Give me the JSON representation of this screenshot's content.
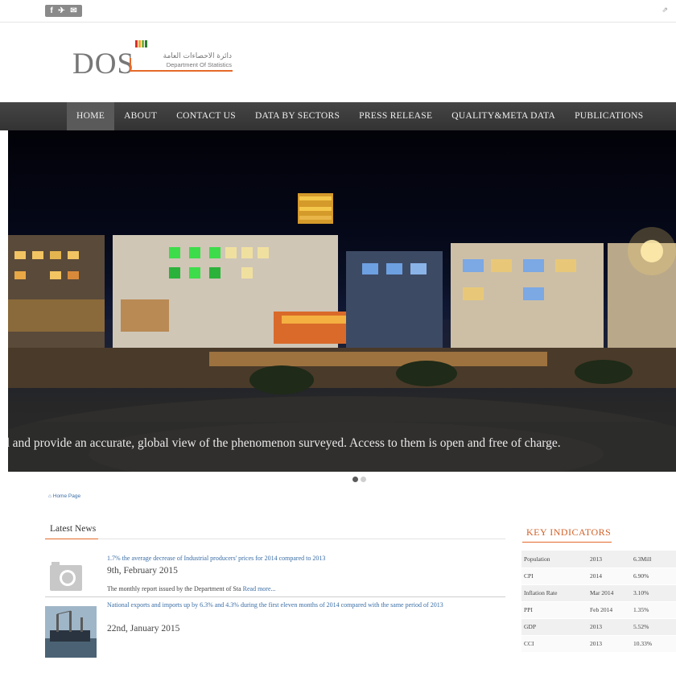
{
  "social": {
    "icons": [
      "f",
      "✈",
      "✉"
    ]
  },
  "logo": {
    "main": "DOS",
    "arabic": "دائرة الاحصاءات العامة",
    "english": "Department Of Statistics",
    "bar_colors": [
      "#d8322c",
      "#f0a830",
      "#7cb342",
      "#2e7d32"
    ],
    "accent": "#e56a2a"
  },
  "nav": {
    "items": [
      {
        "label": "HOME",
        "active": true
      },
      {
        "label": "ABOUT"
      },
      {
        "label": "CONTACT US"
      },
      {
        "label": "DATA BY SECTORS"
      },
      {
        "label": "PRESS RELEASE"
      },
      {
        "label": "QUALITY&META DATA"
      },
      {
        "label": "PUBLICATIONS"
      }
    ]
  },
  "hero": {
    "caption": "d and provide an accurate, global view of the phenomenon surveyed. Access to them is open and free of charge.",
    "slides": 2,
    "active_slide": 1
  },
  "breadcrumb": "Home Page",
  "latest_news": {
    "title": "Latest News",
    "items": [
      {
        "headline": "1.7% the average decrease of Industrial producers' prices for 2014 compared to 2013",
        "date": "9th, February 2015",
        "excerpt": "The monthly report issued by the Department of Sta",
        "read_more": "Read more...",
        "thumb": "camera-placeholder"
      },
      {
        "headline": "National exports and imports up by 6.3% and 4.3% during the first eleven months of 2014 compared with the same period of 2013",
        "date": "22nd, January 2015",
        "thumb": "ship-photo"
      }
    ]
  },
  "key_indicators": {
    "title": "KEY INDICATORS",
    "rows": [
      [
        "Population",
        "2013",
        "6.3Mill"
      ],
      [
        "CPI",
        "2014",
        "6.90%"
      ],
      [
        "Inflation Rate",
        "Mar 2014",
        "3.10%"
      ],
      [
        "PPI",
        "Feb 2014",
        "1.35%"
      ],
      [
        "GDP",
        "2013",
        "5.52%"
      ],
      [
        "CCI",
        "2013",
        "10.33%"
      ]
    ]
  }
}
